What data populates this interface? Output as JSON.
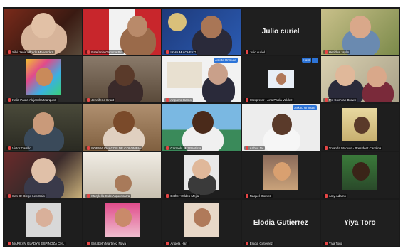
{
  "participants": [
    {
      "name": "Silvi Janis Alfredo Menendez",
      "big": ""
    },
    {
      "name": "Estefania Gamma Pin",
      "big": ""
    },
    {
      "name": "IRMA M ACHEKO",
      "big": ""
    },
    {
      "name": "Julio curiel",
      "big": "Julio curiel"
    },
    {
      "name": "Heridha Jaylin",
      "big": ""
    },
    {
      "name": "Keila Paola Alejandra Marquez",
      "big": ""
    },
    {
      "name": "Jennifer a Brant",
      "big": ""
    },
    {
      "name": "Arquero Gamo",
      "big": "",
      "pill": "Ask to Unmute"
    },
    {
      "name": "Interpreter - Ana Paola Valdez",
      "big": "",
      "pill": "Host"
    },
    {
      "name": "Mo Cochran Brown",
      "big": ""
    },
    {
      "name": "Victor Carrillo",
      "big": ""
    },
    {
      "name": "NORMA CHACON DE COLOMBIA",
      "big": ""
    },
    {
      "name": "Carmela M J Bautista",
      "big": ""
    },
    {
      "name": "Arthur Jai",
      "big": "",
      "pill": "Ask to Unmute"
    },
    {
      "name": "Yolanda Maduro - President Carolina",
      "big": ""
    },
    {
      "name": "Sen Dr Diego Leo Sais",
      "big": ""
    },
    {
      "name": "Marylella C de Alquoncarra",
      "big": ""
    },
    {
      "name": "Esther Valdes Mejia",
      "big": ""
    },
    {
      "name": "Raquel Gomez",
      "big": ""
    },
    {
      "name": "Amy Adams",
      "big": ""
    },
    {
      "name": "MARILYN GLADYS ESPINOZA CHL",
      "big": ""
    },
    {
      "name": "Elizabeth Martinez Nava",
      "big": ""
    },
    {
      "name": "Angela Hart",
      "big": ""
    },
    {
      "name": "Elodia Gutierrez",
      "big": "Elodia Gutierrez"
    },
    {
      "name": "Yiya Toro",
      "big": "Yiya Toro"
    }
  ],
  "colors": {
    "active_border": "#d7e34a",
    "muted_mic": "#e64545",
    "pill": "#2d74d8"
  }
}
